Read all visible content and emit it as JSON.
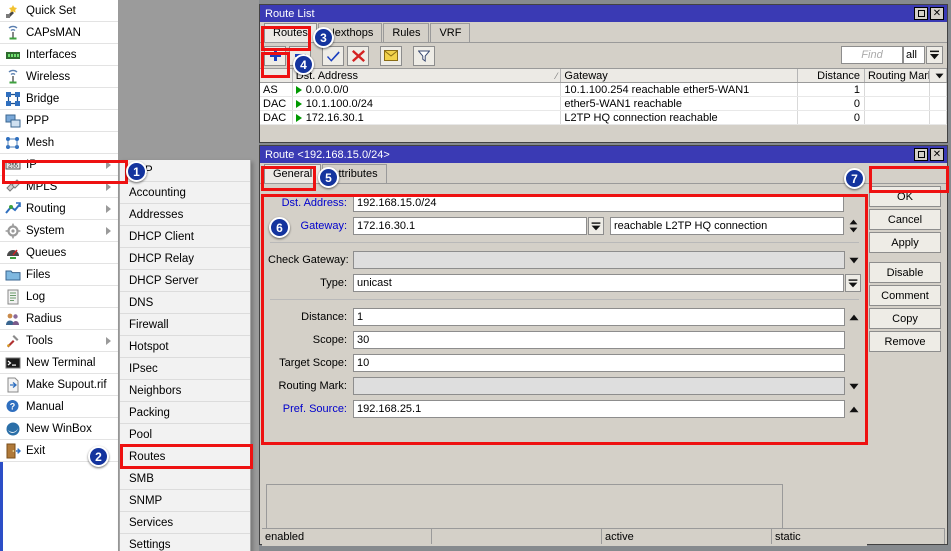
{
  "colors": {
    "accent_blue": "#3a3ab4",
    "highlight_red": "#ee1111",
    "badge_blue": "#14349e",
    "window_face": "#d4d0c8",
    "desktop": "#868a8e",
    "label_blue": "#0000cc",
    "flag_green": "#009900"
  },
  "winbox_menu": {
    "items": [
      {
        "label": "Quick Set",
        "icon": "quick-set-icon",
        "has_arrow": false
      },
      {
        "label": "CAPsMAN",
        "icon": "capsman-icon",
        "has_arrow": false
      },
      {
        "label": "Interfaces",
        "icon": "interfaces-icon",
        "has_arrow": false
      },
      {
        "label": "Wireless",
        "icon": "wireless-icon",
        "has_arrow": false
      },
      {
        "label": "Bridge",
        "icon": "bridge-icon",
        "has_arrow": false
      },
      {
        "label": "PPP",
        "icon": "ppp-icon",
        "has_arrow": false
      },
      {
        "label": "Mesh",
        "icon": "mesh-icon",
        "has_arrow": false
      },
      {
        "label": "IP",
        "icon": "ip-icon",
        "has_arrow": true
      },
      {
        "label": "MPLS",
        "icon": "mpls-icon",
        "has_arrow": true
      },
      {
        "label": "Routing",
        "icon": "routing-icon",
        "has_arrow": true
      },
      {
        "label": "System",
        "icon": "system-icon",
        "has_arrow": true
      },
      {
        "label": "Queues",
        "icon": "queues-icon",
        "has_arrow": false
      },
      {
        "label": "Files",
        "icon": "files-icon",
        "has_arrow": false
      },
      {
        "label": "Log",
        "icon": "log-icon",
        "has_arrow": false
      },
      {
        "label": "Radius",
        "icon": "radius-icon",
        "has_arrow": false
      },
      {
        "label": "Tools",
        "icon": "tools-icon",
        "has_arrow": true
      },
      {
        "label": "New Terminal",
        "icon": "terminal-icon",
        "has_arrow": false
      },
      {
        "label": "Make Supout.rif",
        "icon": "supout-icon",
        "has_arrow": false
      },
      {
        "label": "Manual",
        "icon": "manual-icon",
        "has_arrow": false
      },
      {
        "label": "New WinBox",
        "icon": "new-winbox-icon",
        "has_arrow": false
      },
      {
        "label": "Exit",
        "icon": "exit-icon",
        "has_arrow": false
      }
    ]
  },
  "ip_submenu": {
    "items": [
      {
        "label": "ARP"
      },
      {
        "label": "Accounting"
      },
      {
        "label": "Addresses"
      },
      {
        "label": "DHCP Client"
      },
      {
        "label": "DHCP Relay"
      },
      {
        "label": "DHCP Server"
      },
      {
        "label": "DNS"
      },
      {
        "label": "Firewall"
      },
      {
        "label": "Hotspot"
      },
      {
        "label": "IPsec"
      },
      {
        "label": "Neighbors"
      },
      {
        "label": "Packing"
      },
      {
        "label": "Pool"
      },
      {
        "label": "Routes"
      },
      {
        "label": "SMB"
      },
      {
        "label": "SNMP"
      },
      {
        "label": "Services"
      },
      {
        "label": "Settings"
      }
    ]
  },
  "route_list": {
    "title": "Route List",
    "window_buttons": {
      "maximize": "maximize-icon",
      "close": "×"
    },
    "tabs": [
      {
        "label": "Routes",
        "active": true
      },
      {
        "label": "Nexthops",
        "active": false
      },
      {
        "label": "Rules",
        "active": false
      },
      {
        "label": "VRF",
        "active": false
      }
    ],
    "toolbar": {
      "add": "+",
      "remove": "−",
      "enable": "✔",
      "disable": "✖",
      "comment": "comment-icon",
      "filter": "filter-icon",
      "find_placeholder": "Find",
      "find_value": "",
      "scope_value": "all",
      "scope_caret": "▾"
    },
    "columns": [
      "",
      "Dst. Address",
      "Gateway",
      "Distance",
      "Routing Mark"
    ],
    "sort_marker": "⁄",
    "rows": [
      {
        "flags": "AS",
        "dst": "0.0.0.0/0",
        "gateway": "10.1.100.254 reachable ether5-WAN1",
        "distance": "1",
        "routing_mark": ""
      },
      {
        "flags": "DAC",
        "dst": "10.1.100.0/24",
        "gateway": "ether5-WAN1 reachable",
        "distance": "0",
        "routing_mark": ""
      },
      {
        "flags": "DAC",
        "dst": "172.16.30.1",
        "gateway": "L2TP HQ connection reachable",
        "distance": "0",
        "routing_mark": ""
      }
    ]
  },
  "route_dialog": {
    "title": "Route <192.168.15.0/24>",
    "tabs": [
      {
        "label": "General",
        "active": true
      },
      {
        "label": "Attributes",
        "active": false
      }
    ],
    "fields": {
      "dst_address": {
        "label": "Dst. Address:",
        "value": "192.168.15.0/24",
        "blue_label": true,
        "disabled": false
      },
      "gateway": {
        "label": "Gateway:",
        "value": "172.16.30.1",
        "status": "reachable L2TP HQ connection",
        "blue_label": true,
        "disabled": false
      },
      "check_gateway": {
        "label": "Check Gateway:",
        "value": "",
        "blue_label": false,
        "disabled": true
      },
      "type": {
        "label": "Type:",
        "value": "unicast",
        "blue_label": false,
        "disabled": false
      },
      "distance": {
        "label": "Distance:",
        "value": "1",
        "blue_label": false,
        "disabled": false
      },
      "scope": {
        "label": "Scope:",
        "value": "30",
        "blue_label": false,
        "disabled": false
      },
      "target_scope": {
        "label": "Target Scope:",
        "value": "10",
        "blue_label": false,
        "disabled": false
      },
      "routing_mark": {
        "label": "Routing Mark:",
        "value": "",
        "blue_label": false,
        "disabled": true
      },
      "pref_source": {
        "label": "Pref. Source:",
        "value": "192.168.25.1",
        "blue_label": true,
        "disabled": false
      }
    },
    "buttons": [
      "OK",
      "Cancel",
      "Apply",
      "Disable",
      "Comment",
      "Copy",
      "Remove"
    ],
    "status": [
      "enabled",
      "",
      "active",
      "static"
    ]
  },
  "annotations": [
    {
      "number": "1"
    },
    {
      "number": "2"
    },
    {
      "number": "3"
    },
    {
      "number": "4"
    },
    {
      "number": "5"
    },
    {
      "number": "6"
    },
    {
      "number": "7"
    }
  ]
}
